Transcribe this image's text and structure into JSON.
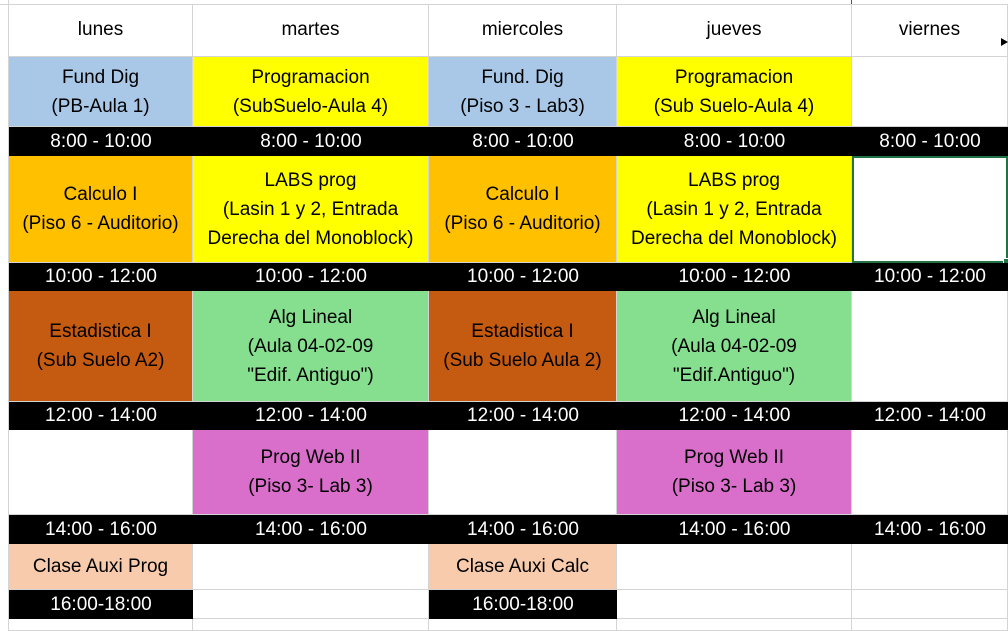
{
  "days": [
    "lunes",
    "martes",
    "miercoles",
    "jueves",
    "viernes"
  ],
  "colors": {
    "blue": "#a9c8e8",
    "yellow": "#ffff00",
    "orange": "#ffc000",
    "rust": "#c55a11",
    "green": "#86df8f",
    "violet": "#d96ecb",
    "peach": "#f8cbad",
    "black": "#000000",
    "white": "#ffffff",
    "selection": "#217346"
  },
  "rows": [
    {
      "time": "8:00 - 10:00",
      "cells": [
        {
          "lines": [
            "Fund Dig",
            "(PB-Aula 1)"
          ],
          "color": "blue"
        },
        {
          "lines": [
            "Programacion",
            "(SubSuelo-Aula 4)"
          ],
          "color": "yellow"
        },
        {
          "lines": [
            "Fund. Dig",
            "(Piso 3 - Lab3)"
          ],
          "color": "blue"
        },
        {
          "lines": [
            "Programacion",
            "(Sub Suelo-Aula 4)"
          ],
          "color": "yellow"
        },
        {
          "lines": [],
          "color": "white"
        }
      ],
      "times": [
        "8:00 - 10:00",
        "8:00 - 10:00",
        "8:00 - 10:00",
        "8:00 - 10:00",
        "8:00 - 10:00"
      ]
    },
    {
      "cells": [
        {
          "lines": [
            "Calculo I",
            "(Piso 6 - Auditorio)"
          ],
          "color": "orange"
        },
        {
          "lines": [
            "LABS prog",
            "(Lasin 1 y  2, Entrada",
            "Derecha del Monoblock)"
          ],
          "color": "yellow"
        },
        {
          "lines": [
            "Calculo I",
            "(Piso 6 - Auditorio)"
          ],
          "color": "orange"
        },
        {
          "lines": [
            "LABS prog",
            "(Lasin 1 y 2, Entrada",
            "Derecha del Monoblock)"
          ],
          "color": "yellow"
        },
        {
          "lines": [],
          "color": "white",
          "selected": true
        }
      ],
      "times": [
        "10:00 - 12:00",
        "10:00 - 12:00",
        "10:00 - 12:00",
        "10:00 - 12:00",
        "10:00 - 12:00"
      ]
    },
    {
      "cells": [
        {
          "lines": [
            "Estadistica I",
            "(Sub Suelo A2)"
          ],
          "color": "rust"
        },
        {
          "lines": [
            "Alg Lineal",
            "(Aula 04-02-09",
            "\"Edif. Antiguo\")"
          ],
          "color": "green"
        },
        {
          "lines": [
            "Estadistica I",
            "(Sub Suelo Aula 2)"
          ],
          "color": "rust"
        },
        {
          "lines": [
            "Alg Lineal",
            "(Aula 04-02-09",
            "\"Edif.Antiguo\")"
          ],
          "color": "green"
        },
        {
          "lines": [],
          "color": "white"
        }
      ],
      "times": [
        "12:00 - 14:00",
        "12:00 - 14:00",
        "12:00 - 14:00",
        "12:00 - 14:00",
        "12:00 - 14:00"
      ]
    },
    {
      "cells": [
        {
          "lines": [],
          "color": "white"
        },
        {
          "lines": [
            "Prog Web II",
            "(Piso 3- Lab 3)"
          ],
          "color": "violet"
        },
        {
          "lines": [],
          "color": "white"
        },
        {
          "lines": [
            "Prog Web II",
            "(Piso 3- Lab 3)"
          ],
          "color": "violet"
        },
        {
          "lines": [],
          "color": "white"
        }
      ],
      "times": [
        "14:00 - 16:00",
        "14:00 - 16:00",
        "14:00 - 16:00",
        "14:00 - 16:00",
        "14:00 - 16:00"
      ]
    },
    {
      "cells": [
        {
          "lines": [
            "Clase Auxi Prog"
          ],
          "color": "peach"
        },
        {
          "lines": [],
          "color": "white"
        },
        {
          "lines": [
            "Clase Auxi Calc"
          ],
          "color": "peach"
        },
        {
          "lines": [],
          "color": "white"
        },
        {
          "lines": [],
          "color": "white"
        }
      ],
      "times": [
        "16:00-18:00",
        "",
        "16:00-18:00",
        "",
        ""
      ]
    }
  ]
}
